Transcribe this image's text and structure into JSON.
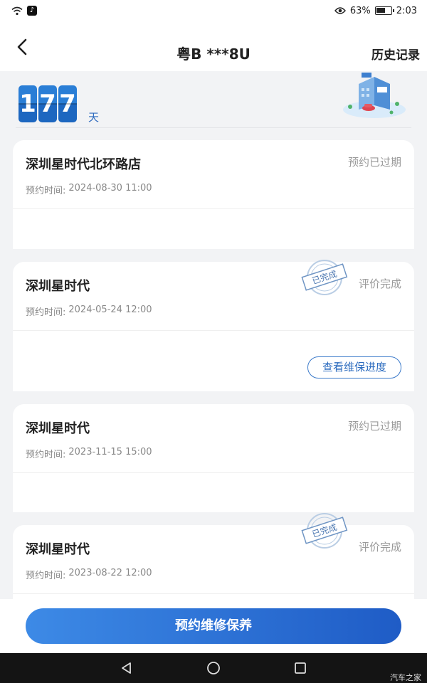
{
  "status_bar": {
    "battery_percent": "63%",
    "battery_level": 0.63,
    "time": "2:03",
    "icons": [
      "wifi-icon",
      "tiktok-icon",
      "eye-icon",
      "battery-icon"
    ]
  },
  "header": {
    "title": "粤B ***8U",
    "history_label": "历史记录",
    "back_icon": "chevron-left-icon"
  },
  "counter": {
    "digits": [
      "1",
      "7",
      "7"
    ],
    "unit": "天"
  },
  "records": [
    {
      "store": "深圳星时代北环路店",
      "status": "预约已过期",
      "time_label": "预约时间:",
      "time": "2024-08-30 11:00",
      "stamp": "",
      "action": ""
    },
    {
      "store": "深圳星时代",
      "status": "评价完成",
      "time_label": "预约时间:",
      "time": "2024-05-24 12:00",
      "stamp": "已完成",
      "action": "查看维保进度"
    },
    {
      "store": "深圳星时代",
      "status": "预约已过期",
      "time_label": "预约时间:",
      "time": "2023-11-15 15:00",
      "stamp": "",
      "action": ""
    },
    {
      "store": "深圳星时代",
      "status": "评价完成",
      "time_label": "预约时间:",
      "time": "2023-08-22 12:00",
      "stamp": "已完成",
      "action": ""
    }
  ],
  "cta": {
    "label": "预约维修保养"
  },
  "nav": {
    "icons": [
      "back-triangle-icon",
      "home-circle-icon",
      "recents-square-icon"
    ]
  },
  "watermark": "汽车之家",
  "colors": {
    "accent": "#2d6cbf",
    "cta_start": "#3d8ae6",
    "cta_end": "#1f5cc6",
    "muted": "#9a9a9a"
  }
}
